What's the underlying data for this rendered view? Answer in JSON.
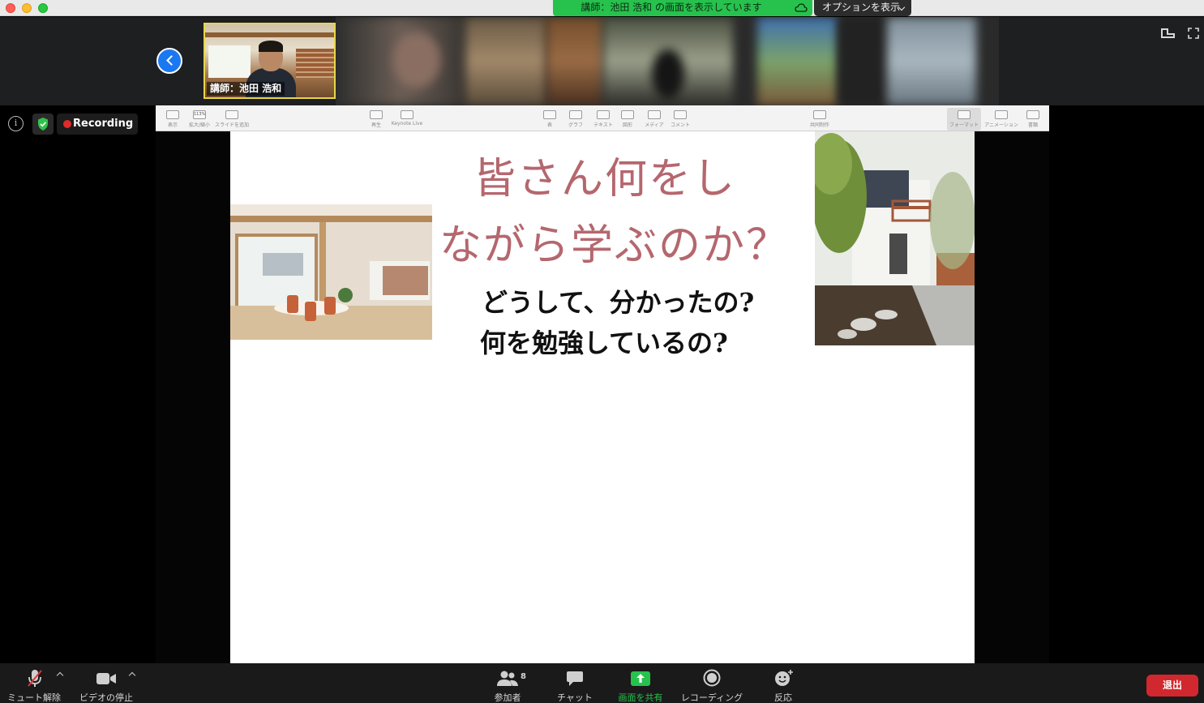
{
  "banner": {
    "share_text": "講師：池田 浩和 の画面を表示しています",
    "options_label": "オプションを表示"
  },
  "speaker": {
    "name": "講師：池田 浩和",
    "highlight_color": "#e6d64a"
  },
  "meeting": {
    "recording_label": "Recording",
    "info_glyph": "i"
  },
  "keynote_toolbar": {
    "items": [
      {
        "label": "表示",
        "icon": "sidebar-icon"
      },
      {
        "label": "拡大/縮小",
        "icon": "zoom-icon",
        "value": "113%"
      },
      {
        "label": "スライドを追加",
        "icon": "plus-icon"
      },
      {
        "label": "再生",
        "icon": "play-icon"
      },
      {
        "label": "Keynote Live",
        "icon": "live-icon"
      },
      {
        "label": "表",
        "icon": "table-icon"
      },
      {
        "label": "グラフ",
        "icon": "chart-icon"
      },
      {
        "label": "テキスト",
        "icon": "text-icon"
      },
      {
        "label": "図形",
        "icon": "shape-icon"
      },
      {
        "label": "メディア",
        "icon": "media-icon"
      },
      {
        "label": "コメント",
        "icon": "comment-icon"
      },
      {
        "label": "共同制作",
        "icon": "collaborate-icon"
      },
      {
        "label": "フォーマット",
        "icon": "format-icon"
      },
      {
        "label": "アニメーション",
        "icon": "animate-icon"
      },
      {
        "label": "書類",
        "icon": "document-icon"
      }
    ]
  },
  "slide": {
    "title_line1": "皆さん何をし",
    "title_line2": "ながら学ぶのか？",
    "sub_line1": "どうして、分かったの?",
    "sub_line2": "何を勉強しているの?",
    "title_color": "#b5676e"
  },
  "toolbar": {
    "mute_label": "ミュート解除",
    "video_label": "ビデオの停止",
    "participants_label": "参加者",
    "participants_count": "8",
    "chat_label": "チャット",
    "share_label": "画面を共有",
    "record_label": "レコーディング",
    "reactions_label": "反応",
    "leave_label": "退出",
    "share_color": "#27c24d",
    "leave_color": "#d0282e"
  }
}
